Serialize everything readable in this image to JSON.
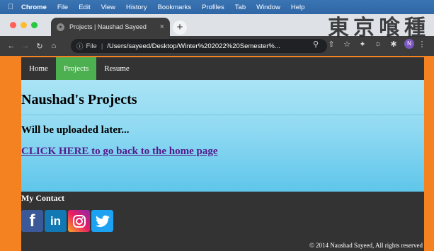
{
  "menubar": {
    "apple_icon": "apple-icon",
    "items": [
      "Chrome",
      "File",
      "Edit",
      "View",
      "History",
      "Bookmarks",
      "Profiles",
      "Tab",
      "Window",
      "Help"
    ]
  },
  "watermark": "東京喰種",
  "tab": {
    "title": "Projects | Naushad Sayeed",
    "close": "×",
    "new_tab": "+"
  },
  "toolbar": {
    "scheme": "File",
    "url": "/Users/sayeed/Desktop/Winter%202022%20Semester%...",
    "profile_initial": "N"
  },
  "nav": {
    "items": [
      {
        "label": "Home",
        "active": false
      },
      {
        "label": "Projects",
        "active": true
      },
      {
        "label": "Resume",
        "active": false
      }
    ]
  },
  "main": {
    "heading": "Naushad's Projects",
    "subheading": "Will be uploaded later...",
    "link_text": "CLICK HERE to go back to the home page"
  },
  "footer": {
    "contact_heading": "My Contact",
    "social": [
      {
        "name": "facebook-icon",
        "glyph": "f"
      },
      {
        "name": "linkedin-icon",
        "glyph": "in"
      },
      {
        "name": "instagram-icon",
        "glyph": ""
      },
      {
        "name": "twitter-icon",
        "glyph": ""
      }
    ],
    "copyright": "© 2014 Naushad Sayeed, All rights reserved"
  },
  "colors": {
    "desktop_background": "#f58220",
    "nav_active": "#4caf50",
    "link": "#551a8b",
    "content_gradient_top": "#a9e4f5",
    "content_gradient_bottom": "#5fc6ea",
    "footer": "#333333"
  }
}
